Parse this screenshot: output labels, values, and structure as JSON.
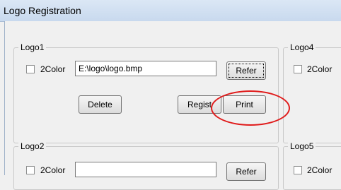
{
  "window": {
    "title": "Logo Registration"
  },
  "groups": [
    {
      "legend": "Logo1",
      "checkbox_label": "2Color",
      "path_value": "E:\\logo\\logo.bmp",
      "refer_label": "Refer",
      "delete_label": "Delete",
      "regist_label": "Regist",
      "print_label": "Print"
    },
    {
      "legend": "Logo4",
      "checkbox_label": "2Color"
    },
    {
      "legend": "Logo2",
      "checkbox_label": "2Color",
      "path_value": "",
      "refer_label": "Refer"
    },
    {
      "legend": "Logo5",
      "checkbox_label": "2Color"
    }
  ],
  "annotation": {
    "color": "#e01b1b",
    "shape": "ellipse-highlight"
  }
}
